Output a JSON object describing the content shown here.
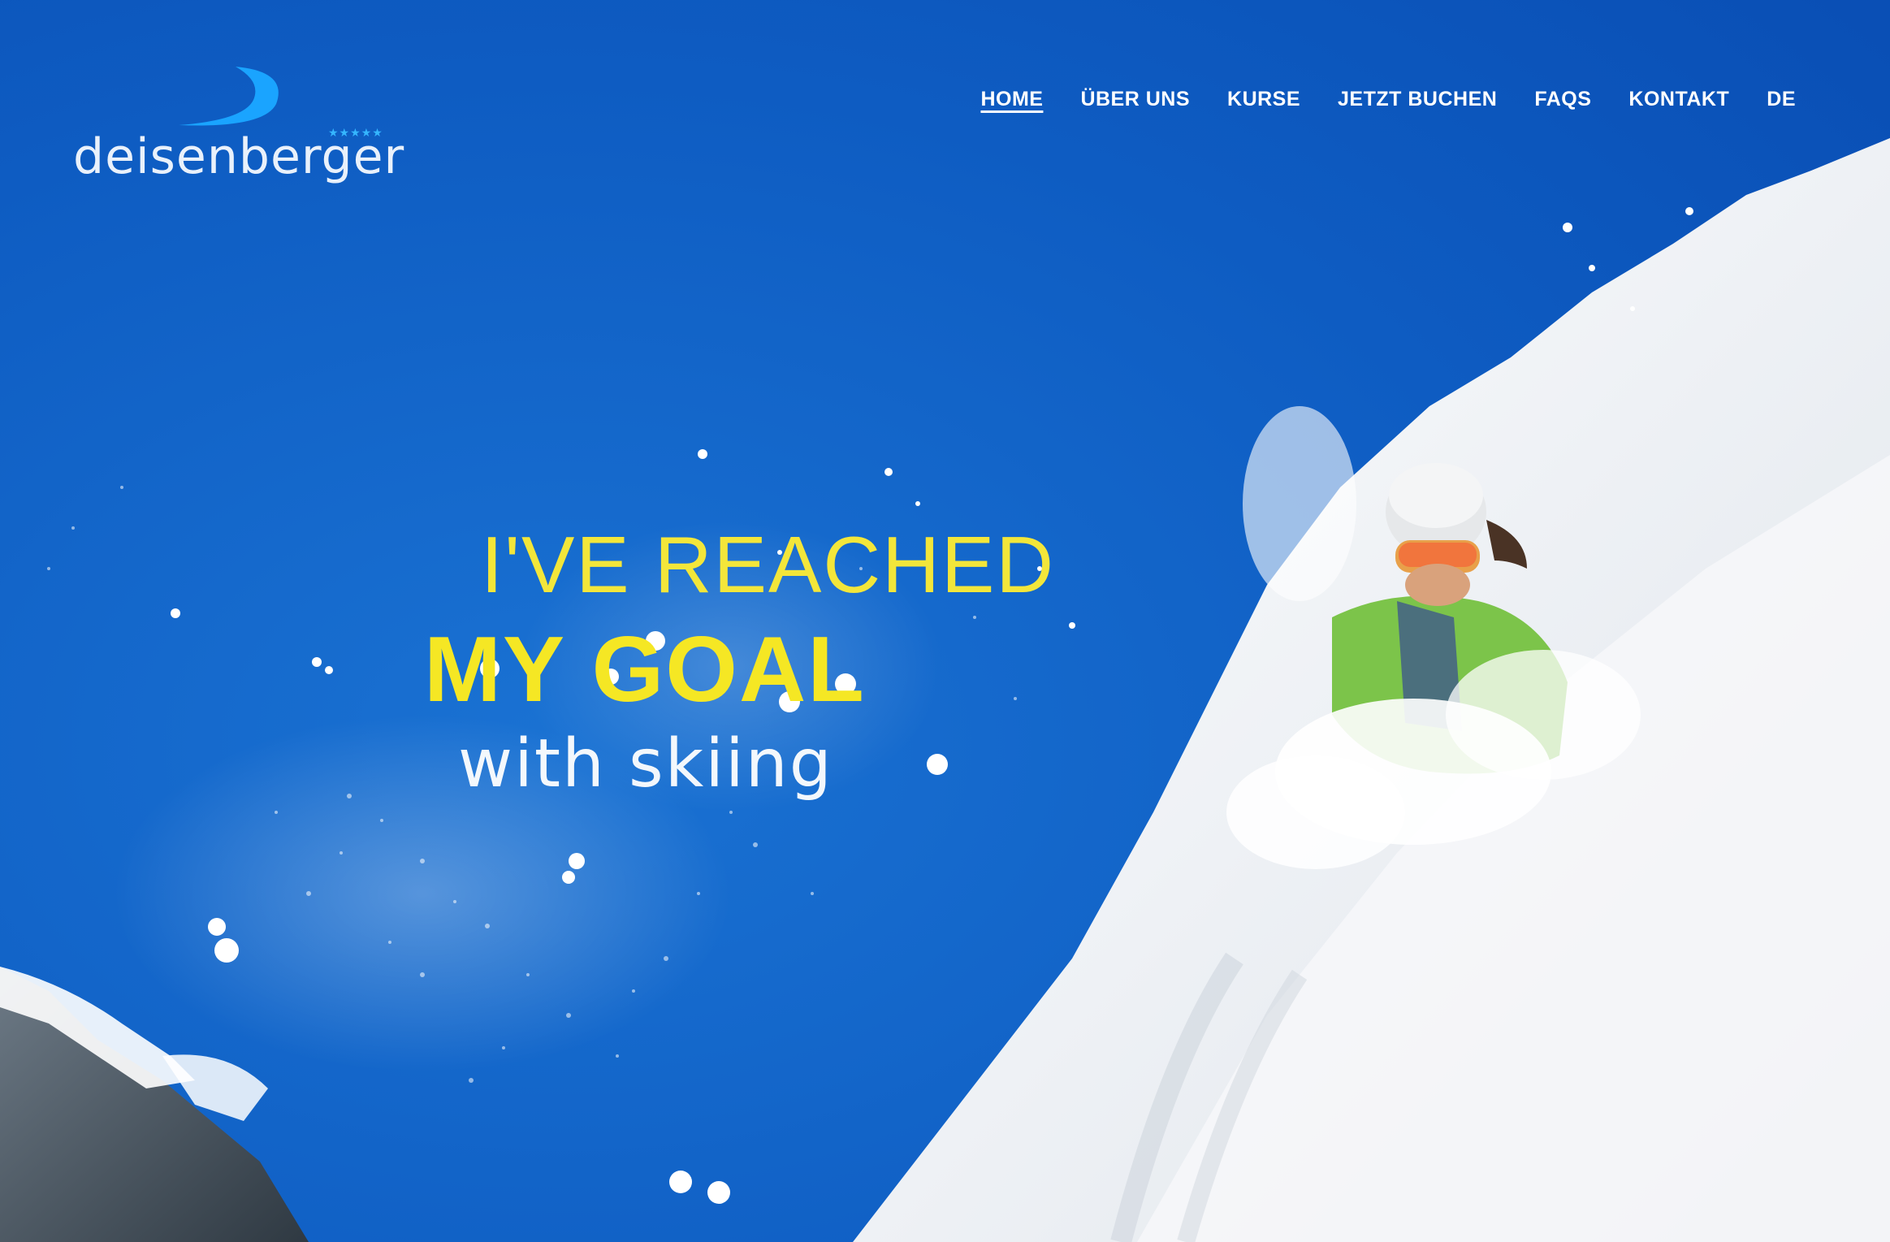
{
  "brand": {
    "name": "deisenberger",
    "stars": "★★★★★",
    "logo_color": "#1aa4ff"
  },
  "nav": {
    "items": [
      {
        "label": "HOME",
        "active": true
      },
      {
        "label": "ÜBER UNS",
        "active": false
      },
      {
        "label": "KURSE",
        "active": false
      },
      {
        "label": "JETZT BUCHEN",
        "active": false
      },
      {
        "label": "FAQS",
        "active": false
      },
      {
        "label": "KONTAKT",
        "active": false
      },
      {
        "label": "DE",
        "active": false
      }
    ]
  },
  "hero": {
    "line1": "I'VE REACHED",
    "line2": "MY GOAL",
    "line3": "with skiing",
    "accent_color": "#f5e724",
    "sky_color": "#0e5cc2",
    "snow_color": "#f2f4f7"
  }
}
